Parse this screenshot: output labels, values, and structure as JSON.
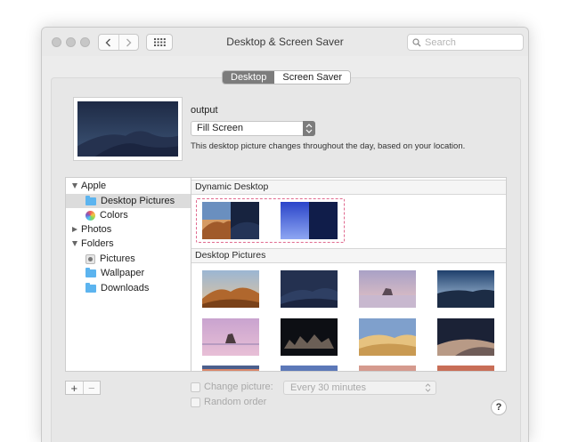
{
  "window": {
    "title": "Desktop & Screen Saver"
  },
  "toolbar": {
    "search_placeholder": "Search"
  },
  "tabs": [
    {
      "label": "Desktop",
      "active": true
    },
    {
      "label": "Screen Saver",
      "active": false
    }
  ],
  "preview": {
    "display_name": "output",
    "fill_mode": "Fill Screen",
    "description": "This desktop picture changes throughout the day, based on your location."
  },
  "sidebar": {
    "items": [
      {
        "label": "Apple",
        "kind": "group",
        "expanded": true
      },
      {
        "label": "Desktop Pictures",
        "kind": "folder",
        "selected": true
      },
      {
        "label": "Colors",
        "kind": "colors"
      },
      {
        "label": "Photos",
        "kind": "group",
        "expanded": false
      },
      {
        "label": "Folders",
        "kind": "group",
        "expanded": true
      },
      {
        "label": "Pictures",
        "kind": "pictures"
      },
      {
        "label": "Wallpaper",
        "kind": "folder"
      },
      {
        "label": "Downloads",
        "kind": "folder"
      }
    ]
  },
  "content": {
    "dynamic_header": "Dynamic Desktop",
    "pictures_header": "Desktop Pictures",
    "dynamic_items": [
      "mojave-dynamic",
      "solar-gradients"
    ],
    "picture_items": [
      "mojave-day",
      "mojave-night",
      "rock-lake",
      "blue-hills",
      "pink-lake-rock",
      "night-rocks",
      "sand-dunes",
      "dark-dunes",
      "sunset-1",
      "sunset-2",
      "sunset-3",
      "sunset-4"
    ]
  },
  "footer": {
    "add_label": "+",
    "remove_label": "−",
    "change_picture_label": "Change picture:",
    "interval": "Every 30 minutes",
    "random_order_label": "Random order",
    "help_label": "?"
  },
  "colors": {
    "accent_selection": "#e06a8f",
    "folder_blue": "#5cb4ef",
    "active_tab": "#7c7c7c"
  }
}
